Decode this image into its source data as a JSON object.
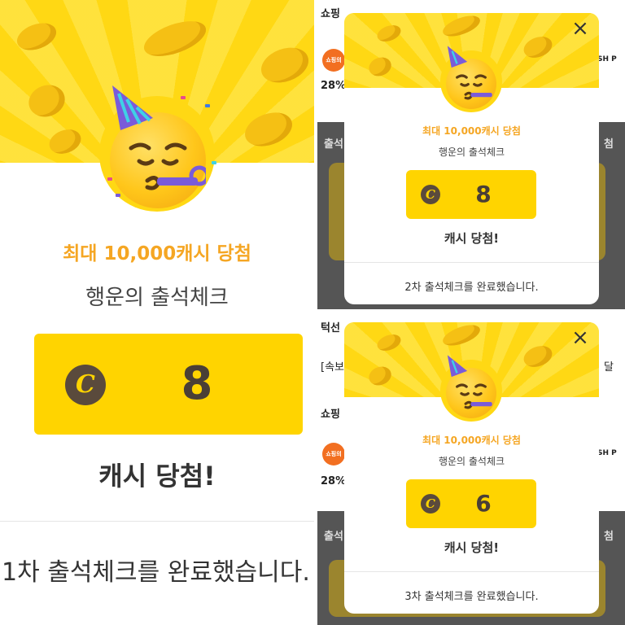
{
  "panels": [
    {
      "headline": "최대 10,000캐시 당첨",
      "subtitle": "행운의 출석체크",
      "amount": "8",
      "coin_symbol": "C",
      "won_label": "캐시 당첨!",
      "done_message": "1차 출석체크를 완료했습니다."
    },
    {
      "headline": "최대 10,000캐시 당첨",
      "subtitle": "행운의 출석체크",
      "amount": "8",
      "coin_symbol": "C",
      "won_label": "캐시 당첨!",
      "done_message": "2차 출석체크를 완료했습니다.",
      "close_label": "×",
      "background": {
        "top_text": "쇼핑",
        "badge_text": "쇼핑의 TEN",
        "percent": "28%",
        "side_text": "SH P",
        "row_text": "출석",
        "row_text_right": "첨"
      }
    },
    {
      "headline": "최대 10,000캐시 당첨",
      "subtitle": "행운의 출석체크",
      "amount": "6",
      "coin_symbol": "C",
      "won_label": "캐시 당첨!",
      "done_message": "3차 출석체크를 완료했습니다.",
      "close_label": "×",
      "background": {
        "top_text": "턱선",
        "news_text": "[속보",
        "news_right": "달",
        "shop_text": "쇼핑",
        "badge_text": "쇼핑의 TEN",
        "percent": "28%",
        "side_text": "SH P",
        "row_text": "출석",
        "row_text_right": "첨"
      }
    }
  ],
  "colors": {
    "banner_yellow": "#ffd814",
    "prize_yellow": "#ffd400",
    "headline_orange": "#f5a623",
    "coin_brown": "#5a4a3c",
    "overlay_gray": "#3b3b3b"
  },
  "icons": {
    "emoji": "partying-face-emoji",
    "coin": "cash-coin-icon",
    "close": "close-icon"
  }
}
